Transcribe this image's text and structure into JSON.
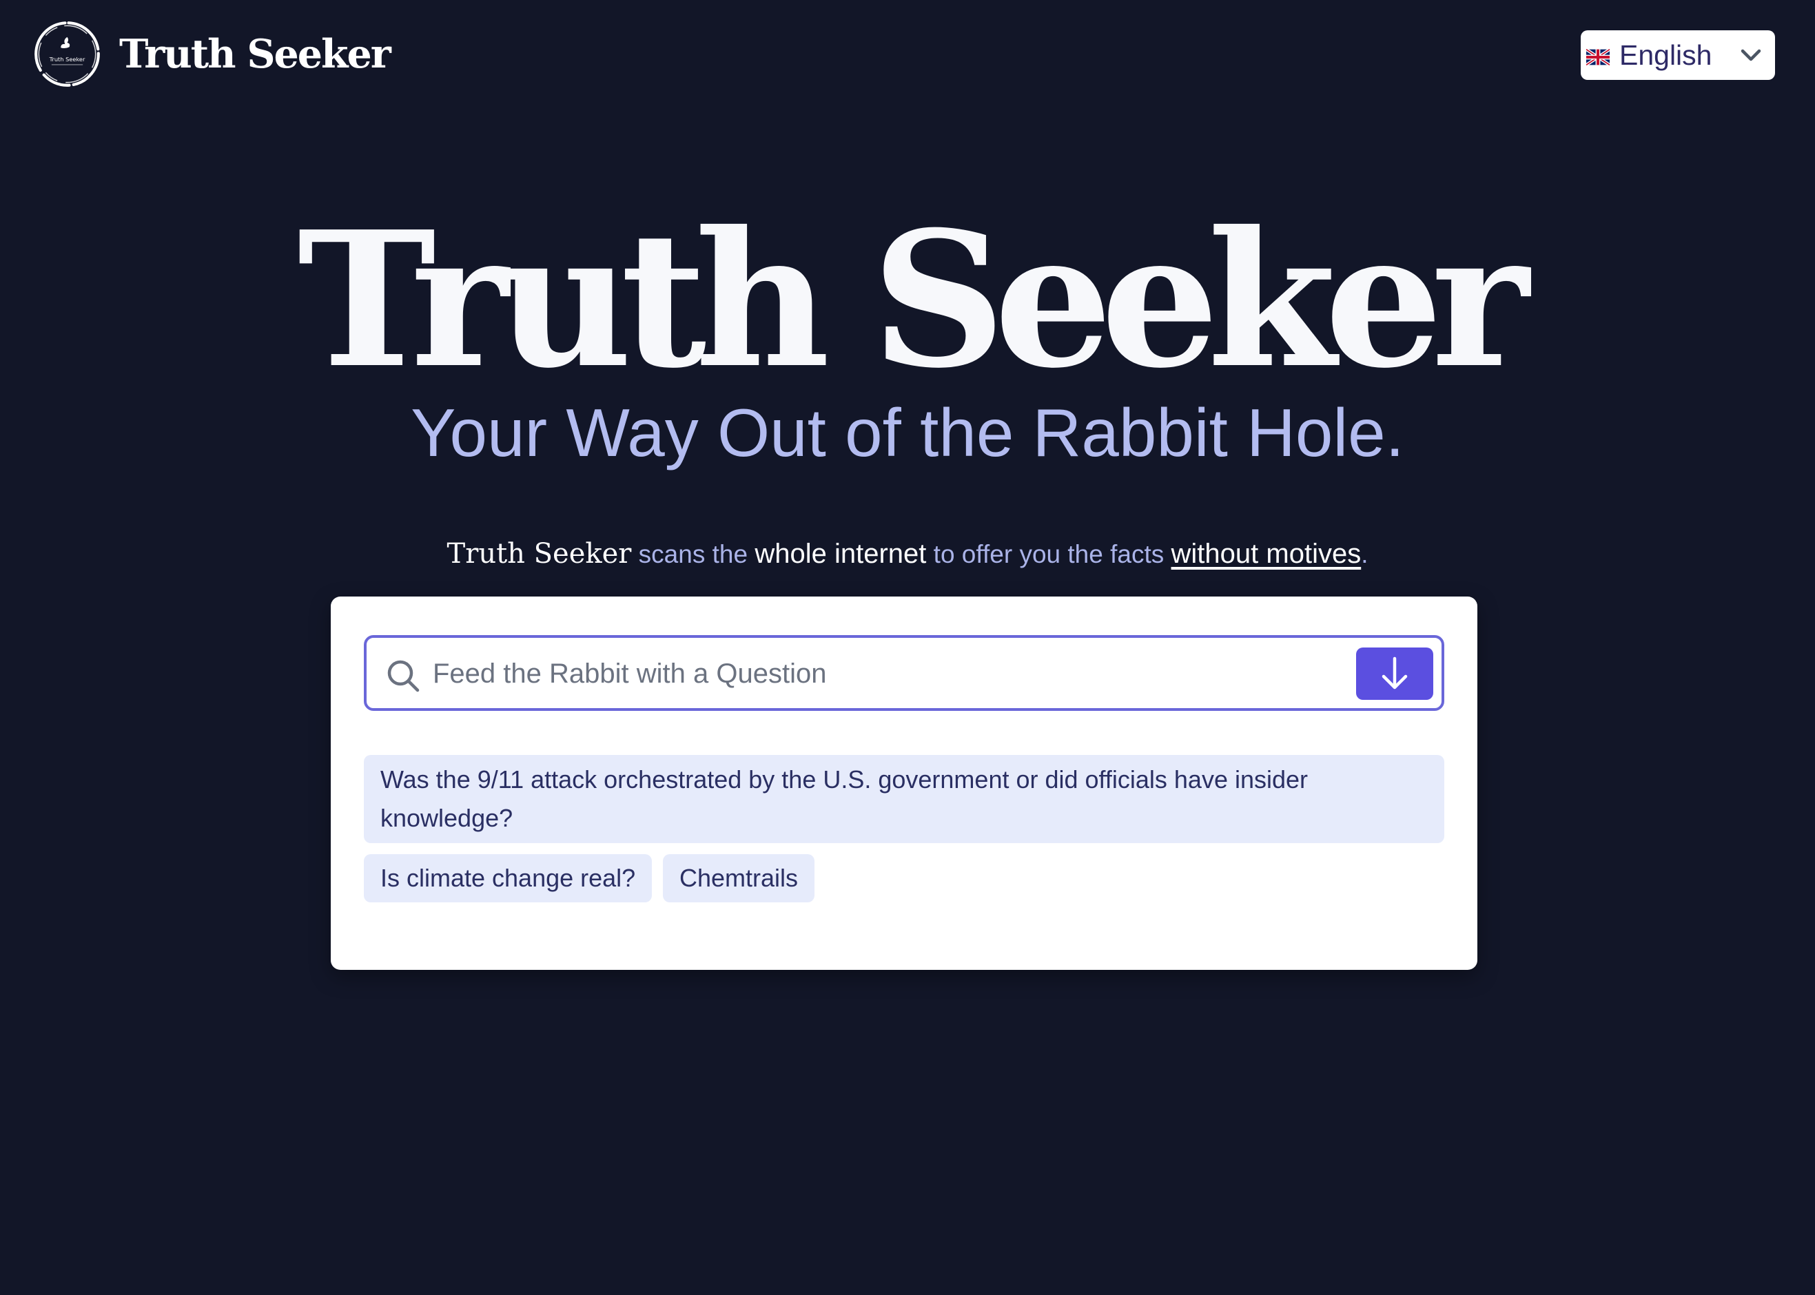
{
  "header": {
    "brand_name": "Truth Seeker",
    "logo_text": "Truth Seeker",
    "language": {
      "selected": "English",
      "flag_icon": "uk-flag-icon",
      "dropdown_icon": "chevron-down-icon"
    }
  },
  "hero": {
    "title": "Truth Seeker",
    "subtitle": "Your Way Out of the Rabbit Hole."
  },
  "tagline": {
    "brand": "Truth Seeker",
    "part1": " scans the ",
    "highlight": "whole internet",
    "part2": " to offer you the facts ",
    "link": "without motives",
    "end": "."
  },
  "search": {
    "placeholder": "Feed the Rabbit with a Question",
    "value": "",
    "icon": "search-icon",
    "submit_icon": "arrow-down-icon"
  },
  "suggestions": [
    "Was the 9/11 attack orchestrated by the U.S. government or did officials have insider knowledge?",
    "Is climate change real?",
    "Chemtrails"
  ],
  "colors": {
    "background": "#121628",
    "accent": "#5b4fe0",
    "input_border": "#6a67d9",
    "subtitle": "#b3bcf0",
    "chip_background": "#e6ebfb",
    "chip_text": "#2a2f63"
  }
}
